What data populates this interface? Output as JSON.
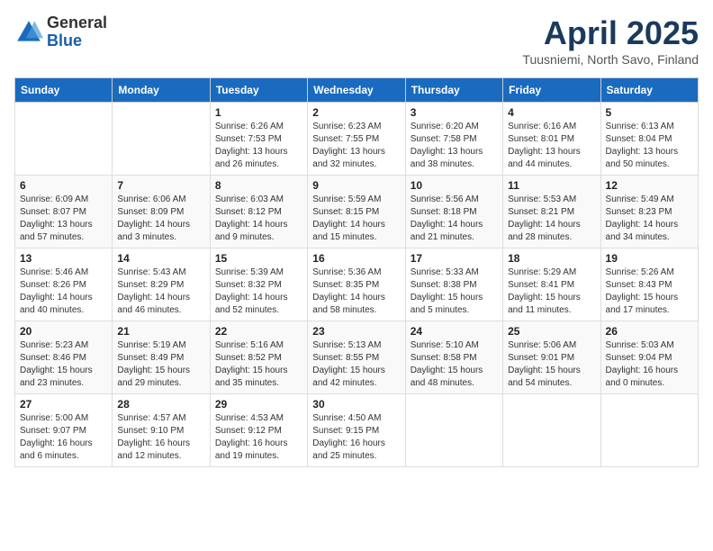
{
  "logo": {
    "general": "General",
    "blue": "Blue"
  },
  "title": "April 2025",
  "subtitle": "Tuusniemi, North Savo, Finland",
  "headers": [
    "Sunday",
    "Monday",
    "Tuesday",
    "Wednesday",
    "Thursday",
    "Friday",
    "Saturday"
  ],
  "weeks": [
    [
      {
        "day": "",
        "info": ""
      },
      {
        "day": "",
        "info": ""
      },
      {
        "day": "1",
        "sunrise": "6:26 AM",
        "sunset": "7:53 PM",
        "daylight": "13 hours and 26 minutes."
      },
      {
        "day": "2",
        "sunrise": "6:23 AM",
        "sunset": "7:55 PM",
        "daylight": "13 hours and 32 minutes."
      },
      {
        "day": "3",
        "sunrise": "6:20 AM",
        "sunset": "7:58 PM",
        "daylight": "13 hours and 38 minutes."
      },
      {
        "day": "4",
        "sunrise": "6:16 AM",
        "sunset": "8:01 PM",
        "daylight": "13 hours and 44 minutes."
      },
      {
        "day": "5",
        "sunrise": "6:13 AM",
        "sunset": "8:04 PM",
        "daylight": "13 hours and 50 minutes."
      }
    ],
    [
      {
        "day": "6",
        "sunrise": "6:09 AM",
        "sunset": "8:07 PM",
        "daylight": "13 hours and 57 minutes."
      },
      {
        "day": "7",
        "sunrise": "6:06 AM",
        "sunset": "8:09 PM",
        "daylight": "14 hours and 3 minutes."
      },
      {
        "day": "8",
        "sunrise": "6:03 AM",
        "sunset": "8:12 PM",
        "daylight": "14 hours and 9 minutes."
      },
      {
        "day": "9",
        "sunrise": "5:59 AM",
        "sunset": "8:15 PM",
        "daylight": "14 hours and 15 minutes."
      },
      {
        "day": "10",
        "sunrise": "5:56 AM",
        "sunset": "8:18 PM",
        "daylight": "14 hours and 21 minutes."
      },
      {
        "day": "11",
        "sunrise": "5:53 AM",
        "sunset": "8:21 PM",
        "daylight": "14 hours and 28 minutes."
      },
      {
        "day": "12",
        "sunrise": "5:49 AM",
        "sunset": "8:23 PM",
        "daylight": "14 hours and 34 minutes."
      }
    ],
    [
      {
        "day": "13",
        "sunrise": "5:46 AM",
        "sunset": "8:26 PM",
        "daylight": "14 hours and 40 minutes."
      },
      {
        "day": "14",
        "sunrise": "5:43 AM",
        "sunset": "8:29 PM",
        "daylight": "14 hours and 46 minutes."
      },
      {
        "day": "15",
        "sunrise": "5:39 AM",
        "sunset": "8:32 PM",
        "daylight": "14 hours and 52 minutes."
      },
      {
        "day": "16",
        "sunrise": "5:36 AM",
        "sunset": "8:35 PM",
        "daylight": "14 hours and 58 minutes."
      },
      {
        "day": "17",
        "sunrise": "5:33 AM",
        "sunset": "8:38 PM",
        "daylight": "15 hours and 5 minutes."
      },
      {
        "day": "18",
        "sunrise": "5:29 AM",
        "sunset": "8:41 PM",
        "daylight": "15 hours and 11 minutes."
      },
      {
        "day": "19",
        "sunrise": "5:26 AM",
        "sunset": "8:43 PM",
        "daylight": "15 hours and 17 minutes."
      }
    ],
    [
      {
        "day": "20",
        "sunrise": "5:23 AM",
        "sunset": "8:46 PM",
        "daylight": "15 hours and 23 minutes."
      },
      {
        "day": "21",
        "sunrise": "5:19 AM",
        "sunset": "8:49 PM",
        "daylight": "15 hours and 29 minutes."
      },
      {
        "day": "22",
        "sunrise": "5:16 AM",
        "sunset": "8:52 PM",
        "daylight": "15 hours and 35 minutes."
      },
      {
        "day": "23",
        "sunrise": "5:13 AM",
        "sunset": "8:55 PM",
        "daylight": "15 hours and 42 minutes."
      },
      {
        "day": "24",
        "sunrise": "5:10 AM",
        "sunset": "8:58 PM",
        "daylight": "15 hours and 48 minutes."
      },
      {
        "day": "25",
        "sunrise": "5:06 AM",
        "sunset": "9:01 PM",
        "daylight": "15 hours and 54 minutes."
      },
      {
        "day": "26",
        "sunrise": "5:03 AM",
        "sunset": "9:04 PM",
        "daylight": "16 hours and 0 minutes."
      }
    ],
    [
      {
        "day": "27",
        "sunrise": "5:00 AM",
        "sunset": "9:07 PM",
        "daylight": "16 hours and 6 minutes."
      },
      {
        "day": "28",
        "sunrise": "4:57 AM",
        "sunset": "9:10 PM",
        "daylight": "16 hours and 12 minutes."
      },
      {
        "day": "29",
        "sunrise": "4:53 AM",
        "sunset": "9:12 PM",
        "daylight": "16 hours and 19 minutes."
      },
      {
        "day": "30",
        "sunrise": "4:50 AM",
        "sunset": "9:15 PM",
        "daylight": "16 hours and 25 minutes."
      },
      {
        "day": "",
        "info": ""
      },
      {
        "day": "",
        "info": ""
      },
      {
        "day": "",
        "info": ""
      }
    ]
  ]
}
